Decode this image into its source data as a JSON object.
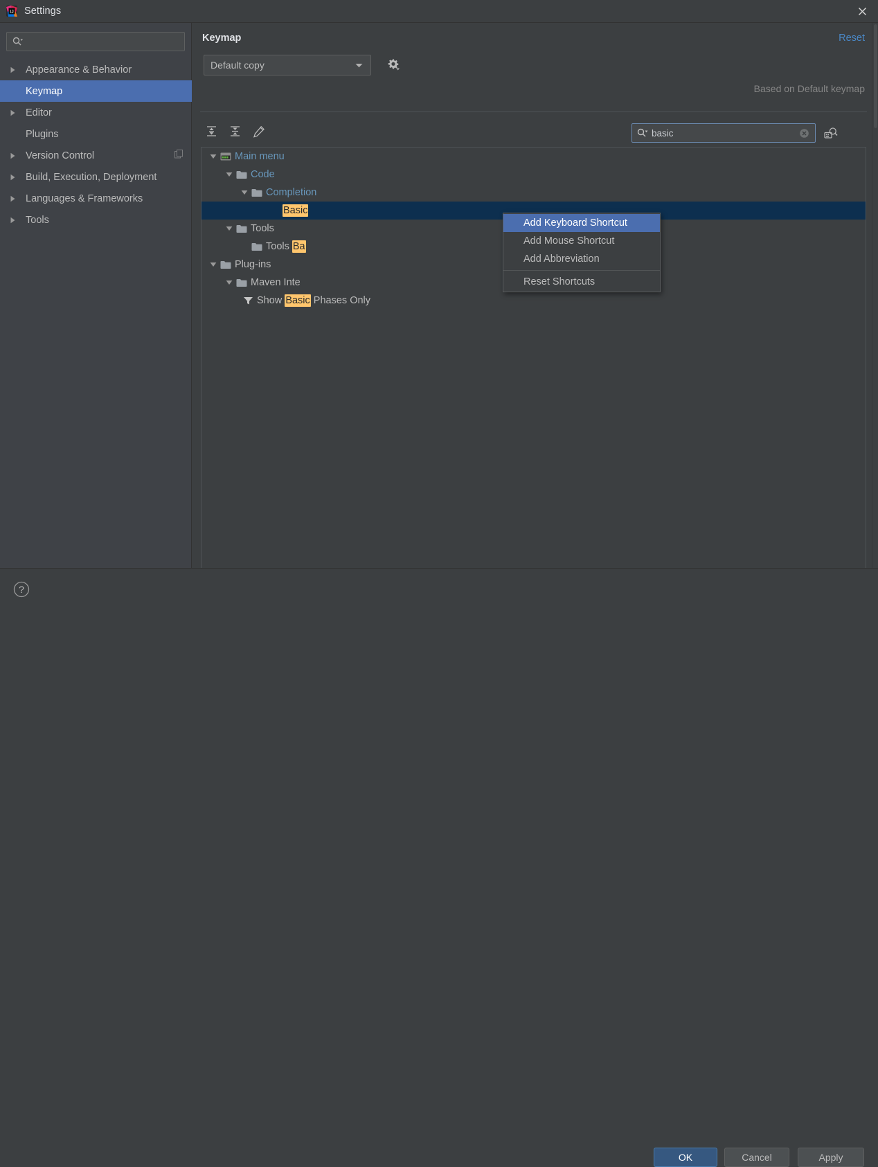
{
  "window": {
    "title": "Settings",
    "app_icon": "intellij-idea-icon",
    "close_icon": "close-icon"
  },
  "sidebar": {
    "search": {
      "value": "",
      "placeholder": "",
      "icon": "search-dropdown-icon"
    },
    "items": [
      {
        "label": "Appearance & Behavior",
        "expandable": true,
        "selected": false,
        "badge": null
      },
      {
        "label": "Keymap",
        "expandable": false,
        "selected": true,
        "badge": null
      },
      {
        "label": "Editor",
        "expandable": true,
        "selected": false,
        "badge": null
      },
      {
        "label": "Plugins",
        "expandable": false,
        "selected": false,
        "badge": null
      },
      {
        "label": "Version Control",
        "expandable": true,
        "selected": false,
        "badge": "copy-icon"
      },
      {
        "label": "Build, Execution, Deployment",
        "expandable": true,
        "selected": false,
        "badge": null
      },
      {
        "label": "Languages & Frameworks",
        "expandable": true,
        "selected": false,
        "badge": null
      },
      {
        "label": "Tools",
        "expandable": true,
        "selected": false,
        "badge": null
      }
    ]
  },
  "panel": {
    "title": "Keymap",
    "reset_label": "Reset",
    "keymap_value": "Default copy",
    "gear_icon": "gear-dropdown-icon",
    "based_on": "Based on Default keymap",
    "toolbar": [
      {
        "name": "expand-all-icon",
        "tooltip": "Expand All"
      },
      {
        "name": "collapse-all-icon",
        "tooltip": "Collapse All"
      },
      {
        "name": "edit-shortcut-icon",
        "tooltip": "Edit Shortcut"
      }
    ],
    "search": {
      "value": "basic",
      "placeholder": "",
      "icon": "search-dropdown-icon",
      "clear_icon": "clear-icon"
    },
    "find_by_shortcut_icon": "find-by-keystroke-icon"
  },
  "tree": {
    "rows": [
      {
        "indent": 0,
        "arrow": "expanded",
        "icon": "main-menu-icon",
        "blue": true,
        "parts": [
          {
            "t": "Main menu",
            "hl": false
          }
        ]
      },
      {
        "indent": 1,
        "arrow": "expanded",
        "icon": "folder-icon",
        "blue": true,
        "parts": [
          {
            "t": "Code",
            "hl": false
          }
        ]
      },
      {
        "indent": 2,
        "arrow": "expanded",
        "icon": "folder-icon",
        "blue": true,
        "parts": [
          {
            "t": "Completion",
            "hl": false
          }
        ]
      },
      {
        "indent": 3,
        "arrow": "none",
        "icon": "none",
        "blue": false,
        "selected": true,
        "parts": [
          {
            "t": "Basic",
            "hl": true
          }
        ]
      },
      {
        "indent": 1,
        "arrow": "expanded",
        "icon": "folder-icon",
        "blue": false,
        "parts": [
          {
            "t": "Tools",
            "hl": false
          }
        ]
      },
      {
        "indent": 2,
        "arrow": "none",
        "icon": "folder-icon",
        "blue": false,
        "parts": [
          {
            "t": "Tools ",
            "hl": false
          },
          {
            "t": "Ba",
            "hl": true
          }
        ]
      },
      {
        "indent": 0,
        "arrow": "expanded",
        "icon": "folder-icon",
        "blue": false,
        "parts": [
          {
            "t": "Plug-ins",
            "hl": false
          }
        ]
      },
      {
        "indent": 1,
        "arrow": "expanded",
        "icon": "folder-icon",
        "blue": false,
        "parts": [
          {
            "t": "Maven Inte",
            "hl": false
          }
        ]
      },
      {
        "indent": 2,
        "arrow": "none",
        "icon": "filter-icon",
        "blue": false,
        "parts": [
          {
            "t": "Show ",
            "hl": false
          },
          {
            "t": "Basic",
            "hl": true
          },
          {
            "t": " Phases Only",
            "hl": false
          }
        ]
      }
    ]
  },
  "context_menu": {
    "items": [
      {
        "label": "Add Keyboard Shortcut",
        "selected": true,
        "separator_after": false
      },
      {
        "label": "Add Mouse Shortcut",
        "selected": false,
        "separator_after": false
      },
      {
        "label": "Add Abbreviation",
        "selected": false,
        "separator_after": true
      },
      {
        "label": "Reset Shortcuts",
        "selected": false,
        "separator_after": false
      }
    ]
  },
  "footer": {
    "help_icon": "help-icon",
    "ok_label": "OK",
    "cancel_label": "Cancel",
    "apply_label": "Apply"
  },
  "colors": {
    "window_bg": "#3c3f41",
    "sidebar_bg": "#3f4247",
    "selection_blue": "#4b6eaf",
    "tree_selection": "#0d2f4f",
    "link_blue": "#4a88c7",
    "tree_blue": "#6897bb",
    "highlight_yellow": "#ffc66d",
    "text": "#bbbbbb",
    "primary_button": "#365880"
  }
}
